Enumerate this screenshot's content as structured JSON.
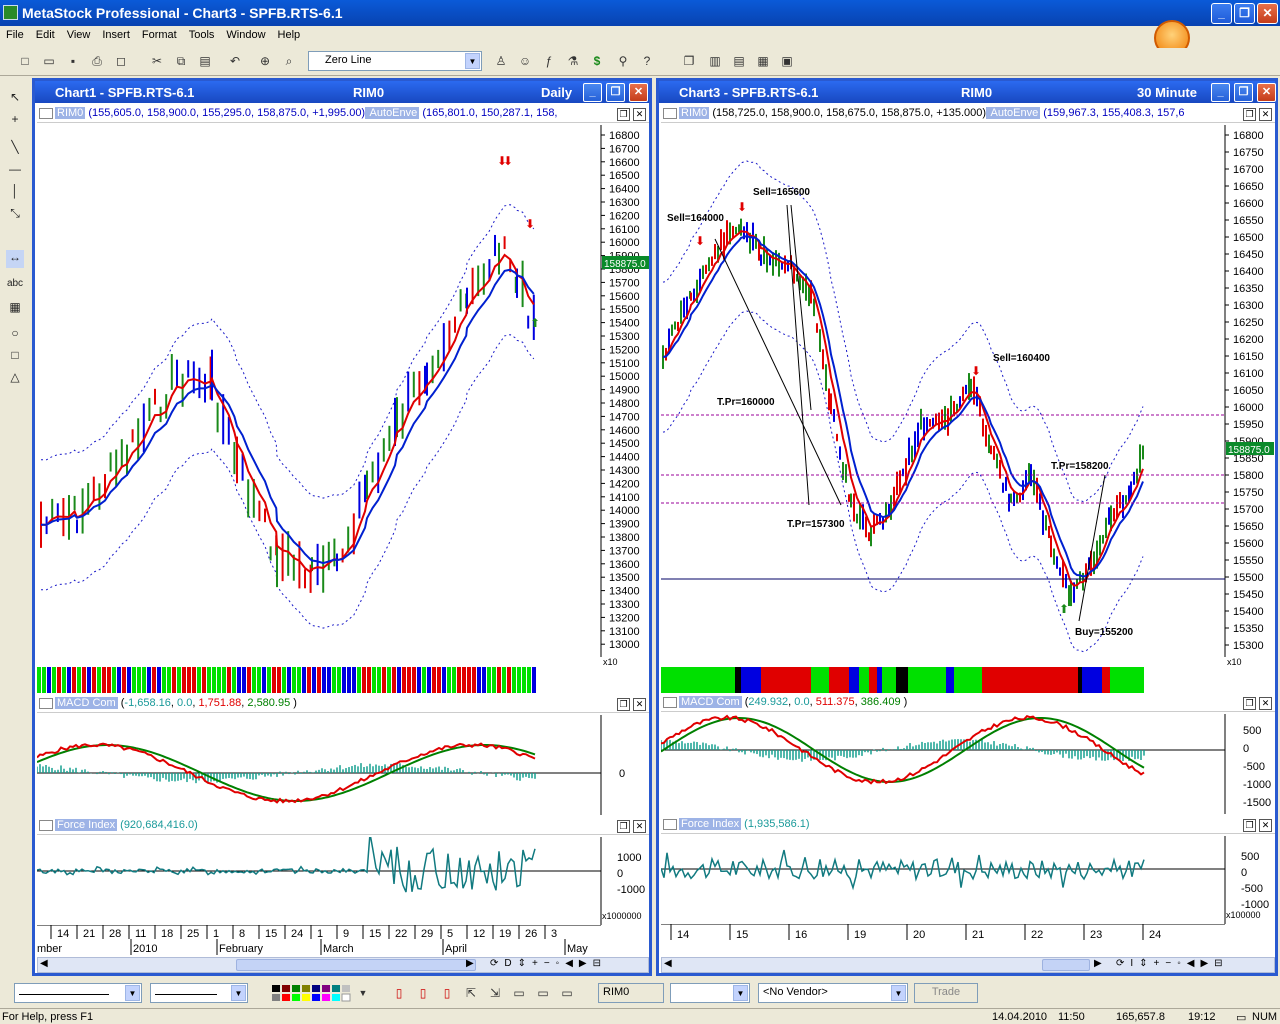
{
  "app": {
    "title": "MetaStock Professional - Chart3 - SPFB.RTS-6.1"
  },
  "menu": [
    "File",
    "Edit",
    "View",
    "Insert",
    "Format",
    "Tools",
    "Window",
    "Help"
  ],
  "toolbar": {
    "line_combo": "Zero Line"
  },
  "chart1": {
    "title": "Chart1 - SPFB.RTS-6.1",
    "symbol": "RIM0",
    "period": "Daily",
    "header_name": "RIM0",
    "header_values": " (155,605.0, 158,900.0, 155,295.0, 158,875.0, +1,995.00)",
    "header_env_name": " AutoEnve",
    "header_env_values": " (165,801.0, 150,287.1, 158,",
    "price_tag": "158875.0",
    "x10": "x10",
    "price_ticks": [
      "16800",
      "16700",
      "16600",
      "16500",
      "16400",
      "16300",
      "16200",
      "16100",
      "16000",
      "15900",
      "15800",
      "15700",
      "15600",
      "15500",
      "15400",
      "15300",
      "15200",
      "15100",
      "15000",
      "14900",
      "14800",
      "14700",
      "14600",
      "14500",
      "14400",
      "14300",
      "14200",
      "14100",
      "14000",
      "13900",
      "13800",
      "13700",
      "13600",
      "13500",
      "13400",
      "13300",
      "13200",
      "13100",
      "13000"
    ],
    "macd_name": "MACD Com",
    "macd_values": [
      " (",
      "-1,658.16",
      ", ",
      "0.0",
      ", ",
      "1,751.88",
      ", ",
      "2,580.95",
      " )"
    ],
    "macd_tick": "0",
    "force_name": "Force Index",
    "force_values": " (920,684,416.0)",
    "force_ticks": [
      "1000",
      "0",
      "-1000"
    ],
    "force_mult": "x1000000",
    "date_ticks": [
      "14",
      "21",
      "28",
      "11",
      "18",
      "25",
      "1",
      "8",
      "15",
      "24",
      "1",
      "9",
      "15",
      "22",
      "29",
      "5",
      "12",
      "19",
      "26",
      "3"
    ],
    "months": [
      "mber",
      "2010",
      "February",
      "March",
      "April",
      "May"
    ]
  },
  "chart3": {
    "title": "Chart3 - SPFB.RTS-6.1",
    "symbol": "RIM0",
    "period": "30 Minute",
    "header_name": "RIM0",
    "header_values": " (158,725.0, 158,900.0, 158,675.0, 158,875.0, +135.000)",
    "header_env_name": " AutoEnve",
    "header_env_values": " (159,967.3, 155,408.3, 157,6",
    "price_tag": "158875.0",
    "x10": "x10",
    "price_ticks": [
      "16800",
      "16750",
      "16700",
      "16650",
      "16600",
      "16550",
      "16500",
      "16450",
      "16400",
      "16350",
      "16300",
      "16250",
      "16200",
      "16150",
      "16100",
      "16050",
      "16000",
      "15950",
      "15900",
      "15850",
      "15800",
      "15750",
      "15700",
      "15650",
      "15600",
      "15550",
      "15500",
      "15450",
      "15400",
      "15350",
      "15300"
    ],
    "annotations": [
      "Sell=165600",
      "Sell=164000",
      "T.Pr=160000",
      "T.Pr=157300",
      "Sell=160400",
      "T.Pr=158200",
      "Buy=155200"
    ],
    "macd_name": "MACD Com",
    "macd_values": [
      " (",
      "249.932",
      ", ",
      "0.0",
      ", ",
      "511.375",
      ", ",
      "386.409",
      " )"
    ],
    "macd_ticks": [
      "500",
      "0",
      "-500",
      "-1000",
      "-1500"
    ],
    "force_name": "Force Index",
    "force_values": " (1,935,586.1)",
    "force_ticks": [
      "500",
      "0",
      "-500",
      "-1000"
    ],
    "force_mult": "x100000",
    "date_ticks": [
      "14",
      "15",
      "16",
      "19",
      "20",
      "21",
      "22",
      "23",
      "24"
    ]
  },
  "bottom": {
    "symbol": "RIM0",
    "vendor": "<No Vendor>",
    "trade": "Trade"
  },
  "status": {
    "help": "For Help, press F1",
    "date": "14.04.2010",
    "time1": "11:50",
    "value": "165,657.8",
    "time2": "19:12",
    "num": "NUM"
  },
  "colors": {
    "up": "#1a8a1a",
    "down": "#e00000",
    "blue": "#0000e0",
    "ema_red": "#e00000",
    "ema_blue": "#0020d0",
    "env": "#1a1ac8",
    "macd_hist": "#17a090",
    "signal": "#008000"
  }
}
